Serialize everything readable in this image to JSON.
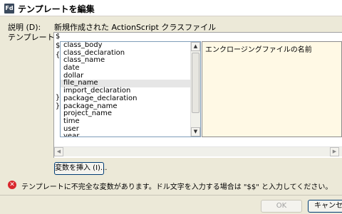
{
  "window": {
    "icon_label": "Fd",
    "title": "テンプレートを編集"
  },
  "form": {
    "description_label": "説明 (D):",
    "description_value": "新規作成された ActionScript クラスファイル",
    "template_label": "テンプレート (T):"
  },
  "editor": {
    "chars": [
      "$",
      "$",
      "{",
      "}",
      "}"
    ]
  },
  "popup": {
    "items": [
      {
        "label": "class_body",
        "selected": false
      },
      {
        "label": "class_declaration",
        "selected": false
      },
      {
        "label": "class_name",
        "selected": false
      },
      {
        "label": "date",
        "selected": false
      },
      {
        "label": "dollar",
        "selected": false
      },
      {
        "label": "file_name",
        "selected": true
      },
      {
        "label": "import_declaration",
        "selected": false
      },
      {
        "label": "package_declaration",
        "selected": false
      },
      {
        "label": "package_name",
        "selected": false
      },
      {
        "label": "project_name",
        "selected": false
      },
      {
        "label": "time",
        "selected": false
      },
      {
        "label": "user",
        "selected": false
      },
      {
        "label": "year",
        "selected": false
      }
    ],
    "info_text": "エンクロージングファイルの名前",
    "scroll_up_glyph": "▲",
    "scroll_down_glyph": "▼"
  },
  "insert_button": {
    "label": "変数を挿入 (I)..."
  },
  "error": {
    "icon_glyph": "✕",
    "message": "テンプレートに不完全な変数があります。ドル文字を入力する場合は \"$$\" と入力してください。"
  },
  "buttons": {
    "ok": "OK",
    "cancel": "キャンセル"
  },
  "colors": {
    "info_background": "#fff9e5",
    "error_icon": "#d9262c",
    "dialog_background": "#ece9d8"
  }
}
